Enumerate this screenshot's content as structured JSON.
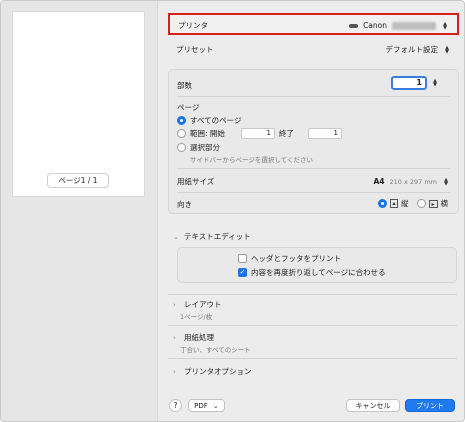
{
  "preview": {
    "page_indicator": "ページ1 / 1"
  },
  "printer": {
    "label": "プリンタ",
    "value": "Canon"
  },
  "presets": {
    "label": "プリセット",
    "value": "デフォルト設定"
  },
  "copies": {
    "label": "部数",
    "value": "1"
  },
  "pages": {
    "label": "ページ",
    "all_label": "すべてのページ",
    "range_label": "範囲: 開始",
    "range_from": "1",
    "range_to_label": "終了",
    "range_to": "1",
    "selection_label": "選択部分",
    "selection_hint": "サイドバーからページを選択してください"
  },
  "paper_size": {
    "label": "用紙サイズ",
    "value": "A4",
    "dimensions": "210 x 297 mm"
  },
  "orientation": {
    "label": "向き",
    "portrait_label": "縦",
    "landscape_label": "横"
  },
  "text_edit": {
    "title": "テキストエディット",
    "header_footer_label": "ヘッダとフッタをプリント",
    "rewrap_label": "内容を再度折り返してページに合わせる",
    "header_footer_checked": false,
    "rewrap_checked": true
  },
  "layout": {
    "title": "レイアウト",
    "summary": "1ページ/枚"
  },
  "paper_handling": {
    "title": "用紙処理",
    "summary": "丁合い、すべてのシート"
  },
  "printer_options": {
    "title": "プリンタオプション"
  },
  "footer": {
    "help_label": "?",
    "pdf_label": "PDF",
    "cancel_label": "キャンセル",
    "print_label": "プリント"
  },
  "colors": {
    "accent": "#1f7af0",
    "highlight_border": "#d6211e"
  }
}
